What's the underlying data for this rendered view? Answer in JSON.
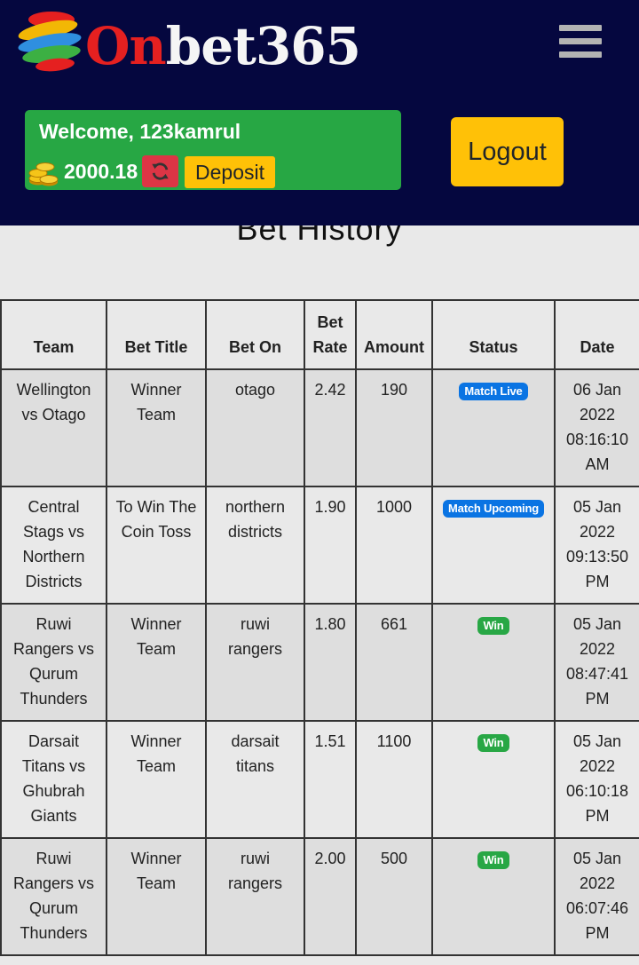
{
  "brand": {
    "name_highlight": "On",
    "name_rest": "bet365"
  },
  "header": {
    "welcome": "Welcome, 123kamrul",
    "balance": "2000.18",
    "deposit_label": "Deposit",
    "logout_label": "Logout"
  },
  "colors": {
    "header_bg": "#05073f",
    "welcome_bg": "#27a744",
    "deposit_bg": "#ffc107",
    "refresh_bg": "#dc3545",
    "badge_live": "#0a74e3",
    "badge_win": "#28a745"
  },
  "icons": [
    "menu-icon",
    "coins-icon",
    "refresh-icon"
  ],
  "page": {
    "title": "Bet History"
  },
  "table": {
    "columns": [
      "Team",
      "Bet Title",
      "Bet On",
      "Bet Rate",
      "Amount",
      "Status",
      "Date"
    ],
    "rows": [
      {
        "team": "Wellington vs Otago",
        "bet_title": "Winner Team",
        "bet_on": "otago",
        "bet_rate": "2.42",
        "amount": "190",
        "status": "Match Live",
        "date": "06 Jan 2022 08:16:10 AM"
      },
      {
        "team": "Central Stags vs Northern Districts",
        "bet_title": "To Win The Coin Toss",
        "bet_on": "northern districts",
        "bet_rate": "1.90",
        "amount": "1000",
        "status": "Match Upcoming",
        "date": "05 Jan 2022 09:13:50 PM"
      },
      {
        "team": "Ruwi Rangers vs Qurum Thunders",
        "bet_title": "Winner Team",
        "bet_on": "ruwi rangers",
        "bet_rate": "1.80",
        "amount": "661",
        "status": "Win",
        "date": "05 Jan 2022 08:47:41 PM"
      },
      {
        "team": "Darsait Titans vs Ghubrah Giants",
        "bet_title": "Winner Team",
        "bet_on": "darsait titans",
        "bet_rate": "1.51",
        "amount": "1100",
        "status": "Win",
        "date": "05 Jan 2022 06:10:18 PM"
      },
      {
        "team": "Ruwi Rangers vs Qurum Thunders",
        "bet_title": "Winner Team",
        "bet_on": "ruwi rangers",
        "bet_rate": "2.00",
        "amount": "500",
        "status": "Win",
        "date": "05 Jan 2022 06:07:46 PM"
      }
    ]
  }
}
